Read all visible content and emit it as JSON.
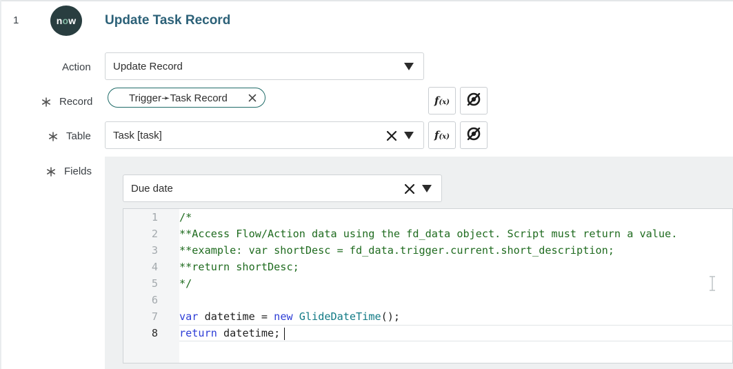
{
  "step": {
    "number": "1",
    "logo_text_n": "n",
    "logo_text_o": "o",
    "logo_text_w": "w",
    "title": "Update Task Record"
  },
  "action": {
    "label": "Action",
    "value": "Update Record"
  },
  "record": {
    "label": "Record",
    "pill_text": "Trigger➛Task Record"
  },
  "table": {
    "label": "Table",
    "value": "Task [task]"
  },
  "fields": {
    "label": "Fields",
    "field_select_value": "Due date"
  },
  "buttons": {
    "fx_main": "f",
    "fx_sub": "(x)"
  },
  "code": {
    "active_line": 8,
    "lines": [
      {
        "num": "1",
        "tokens": [
          {
            "t": "/*",
            "c": "comment"
          }
        ]
      },
      {
        "num": "2",
        "tokens": [
          {
            "t": "**Access Flow/Action data using the fd_data object. Script must return a value.",
            "c": "comment"
          }
        ]
      },
      {
        "num": "3",
        "tokens": [
          {
            "t": "**example: var shortDesc = fd_data.trigger.current.short_description;",
            "c": "comment"
          }
        ]
      },
      {
        "num": "4",
        "tokens": [
          {
            "t": "**return shortDesc;",
            "c": "comment"
          }
        ]
      },
      {
        "num": "5",
        "tokens": [
          {
            "t": "*/",
            "c": "comment"
          }
        ]
      },
      {
        "num": "6",
        "tokens": []
      },
      {
        "num": "7",
        "tokens": [
          {
            "t": "var",
            "c": "kw"
          },
          {
            "t": " datetime = ",
            "c": "plain"
          },
          {
            "t": "new",
            "c": "kw"
          },
          {
            "t": " ",
            "c": "plain"
          },
          {
            "t": "GlideDateTime",
            "c": "type"
          },
          {
            "t": "();",
            "c": "plain"
          }
        ]
      },
      {
        "num": "8",
        "tokens": [
          {
            "t": "return",
            "c": "kw"
          },
          {
            "t": " datetime;",
            "c": "plain"
          }
        ]
      }
    ]
  },
  "colors": {
    "accent": "#2c6178",
    "logo_bg": "#293e40",
    "logo_o": "#81b5a1",
    "pill_border": "#1f6b68",
    "comment": "#1f6b1f",
    "keyword": "#2d3dd6",
    "type": "#117a85"
  },
  "icons": {
    "required": "asterisk-icon",
    "dropdown": "triangle-down-icon",
    "clear": "close-x-icon",
    "function": "fx-icon",
    "data_pill_picker": "data-pill-icon",
    "text_cursor": "ibeam-cursor-icon"
  }
}
